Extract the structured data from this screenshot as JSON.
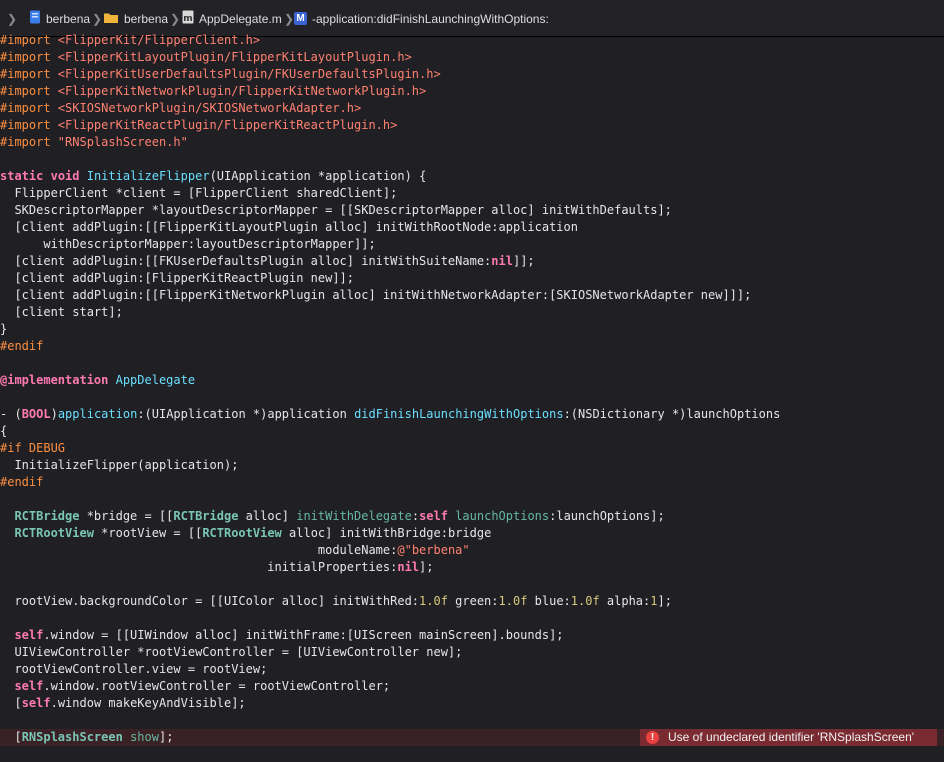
{
  "jumpbar": {
    "project": "berbena",
    "folder": "berbena",
    "file": "AppDelegate.m",
    "method_badge": "M",
    "method": "-application:didFinishLaunchingWithOptions:"
  },
  "code": [
    [
      [
        "pp",
        "#import "
      ],
      [
        "inc",
        "<FlipperKit/FlipperClient.h>"
      ]
    ],
    [
      [
        "pp",
        "#import "
      ],
      [
        "inc",
        "<FlipperKitLayoutPlugin/FlipperKitLayoutPlugin.h>"
      ]
    ],
    [
      [
        "pp",
        "#import "
      ],
      [
        "inc",
        "<FlipperKitUserDefaultsPlugin/FKUserDefaultsPlugin.h>"
      ]
    ],
    [
      [
        "pp",
        "#import "
      ],
      [
        "inc",
        "<FlipperKitNetworkPlugin/FlipperKitNetworkPlugin.h>"
      ]
    ],
    [
      [
        "pp",
        "#import "
      ],
      [
        "inc",
        "<SKIOSNetworkPlugin/SKIOSNetworkAdapter.h>"
      ]
    ],
    [
      [
        "pp",
        "#import "
      ],
      [
        "inc",
        "<FlipperKitReactPlugin/FlipperKitReactPlugin.h>"
      ]
    ],
    [
      [
        "pp",
        "#import "
      ],
      [
        "inc",
        "\"RNSplashScreen.h\""
      ]
    ],
    [],
    [
      [
        "kw",
        "static"
      ],
      [
        "pl",
        " "
      ],
      [
        "kw",
        "void"
      ],
      [
        "pl",
        " "
      ],
      [
        "fn",
        "InitializeFlipper"
      ],
      [
        "pl",
        "(UIApplication *application) {"
      ]
    ],
    [
      [
        "pl",
        "  FlipperClient *client = [FlipperClient sharedClient];"
      ]
    ],
    [
      [
        "pl",
        "  SKDescriptorMapper *layoutDescriptorMapper = [[SKDescriptorMapper alloc] initWithDefaults];"
      ]
    ],
    [
      [
        "pl",
        "  [client addPlugin:[[FlipperKitLayoutPlugin alloc] initWithRootNode:application"
      ]
    ],
    [
      [
        "pl",
        "      withDescriptorMapper:layoutDescriptorMapper]];"
      ]
    ],
    [
      [
        "pl",
        "  [client addPlugin:[[FKUserDefaultsPlugin alloc] initWithSuiteName:"
      ],
      [
        "kw",
        "nil"
      ],
      [
        "pl",
        "]];"
      ]
    ],
    [
      [
        "pl",
        "  [client addPlugin:[FlipperKitReactPlugin new]];"
      ]
    ],
    [
      [
        "pl",
        "  [client addPlugin:[[FlipperKitNetworkPlugin alloc] initWithNetworkAdapter:[SKIOSNetworkAdapter new]]];"
      ]
    ],
    [
      [
        "pl",
        "  [client start];"
      ]
    ],
    [
      [
        "pl",
        "}"
      ]
    ],
    [
      [
        "pp",
        "#endif"
      ]
    ],
    [],
    [
      [
        "kw",
        "@implementation"
      ],
      [
        "pl",
        " "
      ],
      [
        "fn",
        "AppDelegate"
      ]
    ],
    [],
    [
      [
        "pl",
        "- ("
      ],
      [
        "kw",
        "BOOL"
      ],
      [
        "pl",
        ")"
      ],
      [
        "fn",
        "application"
      ],
      [
        "pl",
        ":(UIApplication *)application "
      ],
      [
        "fn",
        "didFinishLaunchingWithOptions"
      ],
      [
        "pl",
        ":(NSDictionary *)launchOptions"
      ]
    ],
    [
      [
        "pl",
        "{"
      ]
    ],
    [
      [
        "pp",
        "#if DEBUG"
      ]
    ],
    [
      [
        "pl",
        "  InitializeFlipper(application);"
      ]
    ],
    [
      [
        "pp",
        "#endif"
      ]
    ],
    [],
    [
      [
        "pl",
        "  "
      ],
      [
        "cls",
        "RCTBridge"
      ],
      [
        "pl",
        " *bridge = [["
      ],
      [
        "cls",
        "RCTBridge"
      ],
      [
        "pl",
        " alloc] "
      ],
      [
        "sel",
        "initWithDelegate"
      ],
      [
        "pl",
        ":"
      ],
      [
        "kw",
        "self"
      ],
      [
        "pl",
        " "
      ],
      [
        "sel",
        "launchOptions"
      ],
      [
        "pl",
        ":launchOptions];"
      ]
    ],
    [
      [
        "pl",
        "  "
      ],
      [
        "cls",
        "RCTRootView"
      ],
      [
        "pl",
        " *rootView = [["
      ],
      [
        "cls",
        "RCTRootView"
      ],
      [
        "pl",
        " alloc] initWithBridge:bridge"
      ]
    ],
    [
      [
        "pl",
        "                                            moduleName:"
      ],
      [
        "at",
        "@"
      ],
      [
        "str",
        "\"berbena\""
      ]
    ],
    [
      [
        "pl",
        "                                     initialProperties:"
      ],
      [
        "kw",
        "nil"
      ],
      [
        "pl",
        "];"
      ]
    ],
    [],
    [
      [
        "pl",
        "  rootView.backgroundColor = [[UIColor alloc] initWithRed:"
      ],
      [
        "num",
        "1.0f"
      ],
      [
        "pl",
        " green:"
      ],
      [
        "num",
        "1.0f"
      ],
      [
        "pl",
        " blue:"
      ],
      [
        "num",
        "1.0f"
      ],
      [
        "pl",
        " alpha:"
      ],
      [
        "num",
        "1"
      ],
      [
        "pl",
        "];"
      ]
    ],
    [],
    [
      [
        "pl",
        "  "
      ],
      [
        "kw",
        "self"
      ],
      [
        "pl",
        ".window = [[UIWindow alloc] initWithFrame:[UIScreen mainScreen].bounds];"
      ]
    ],
    [
      [
        "pl",
        "  UIViewController *rootViewController = [UIViewController new];"
      ]
    ],
    [
      [
        "pl",
        "  rootViewController.view = rootView;"
      ]
    ],
    [
      [
        "pl",
        "  "
      ],
      [
        "kw",
        "self"
      ],
      [
        "pl",
        ".window.rootViewController = rootViewController;"
      ]
    ],
    [
      [
        "pl",
        "  ["
      ],
      [
        "kw",
        "self"
      ],
      [
        "pl",
        ".window makeKeyAndVisible];"
      ]
    ],
    [],
    [
      [
        "pl",
        "  ["
      ],
      [
        "cls",
        "RNSplashScreen"
      ],
      [
        "pl",
        " "
      ],
      [
        "sel",
        "show"
      ],
      [
        "pl",
        "];"
      ]
    ]
  ],
  "error": {
    "icon": "error-circle-icon",
    "message": "Use of undeclared identifier 'RNSplashScreen'"
  }
}
